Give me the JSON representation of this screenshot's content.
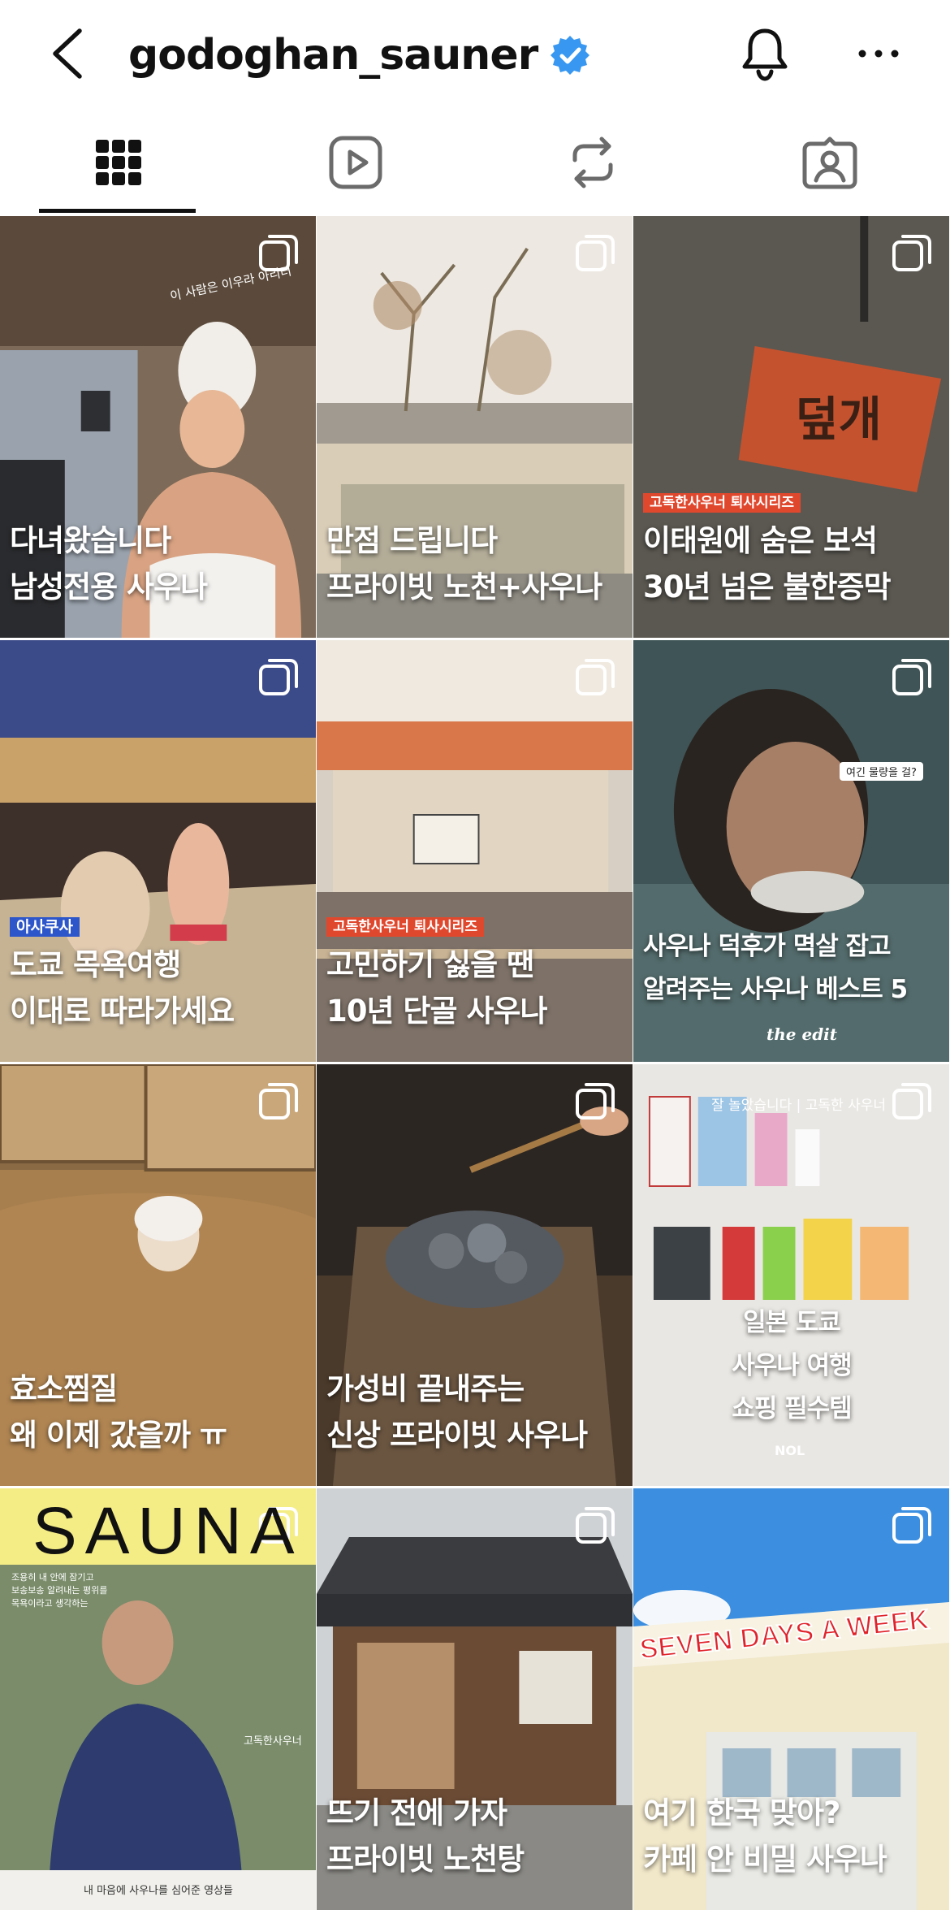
{
  "header": {
    "username": "godoghan_sauner",
    "back_icon": "chevron-left-icon",
    "verified_icon": "verified-badge-icon",
    "bell_icon": "bell-icon",
    "more_icon": "more-horizontal-icon",
    "verified_color": "#3897f0"
  },
  "tabs": [
    {
      "name": "grid",
      "icon": "grid-icon",
      "selected": true
    },
    {
      "name": "reels",
      "icon": "reels-icon",
      "selected": false
    },
    {
      "name": "reposts",
      "icon": "repost-icon",
      "selected": false
    },
    {
      "name": "tagged",
      "icon": "tagged-user-icon",
      "selected": false
    }
  ],
  "posts": [
    {
      "lines": [
        "다녀왔습니다",
        "남성전용 사우나"
      ],
      "overlay": "이 사람은 이우라 아리터"
    },
    {
      "lines": [
        "만점 드립니다",
        "프라이빗 노천+사우나"
      ]
    },
    {
      "badge": "고독한사우너 퇴사시리즈",
      "lines": [
        "이태원에 숨은 보석",
        "30년 넘은 불한증막"
      ],
      "sign": "덮개"
    },
    {
      "badge": "아사쿠사",
      "lines": [
        "도쿄 목욕여행",
        "이대로 따라가세요"
      ]
    },
    {
      "badge": "고독한사우너 퇴사시리즈",
      "lines": [
        "고민하기 싫을 땐",
        "10년 단골 사우나"
      ]
    },
    {
      "lines": [
        "사우나 덕후가 멱살 잡고",
        "알려주는 사우나 베스트 5"
      ],
      "tag": "여긴 물량을 걸?",
      "brand": "the edit"
    },
    {
      "lines": [
        "효소찜질",
        "왜 이제 갔을까 ㅠ"
      ]
    },
    {
      "lines": [
        "가성비 끝내주는",
        "신상 프라이빗 사우나"
      ]
    },
    {
      "lines": [
        "일본 도쿄",
        "사우나 여행",
        "쇼핑 필수템"
      ],
      "top_text": "잘 놀았습니다 | 고독한 사우너",
      "brand": "NOL"
    },
    {
      "headline": "SAUNA",
      "lines": [],
      "small_text": [
        "조용히 내 안에 잠기고",
        "보송보송 알려내는 평위를",
        "목욕이라고 생각하는"
      ],
      "side_text": "고독한사우너",
      "bottom_text": "내 마음에 사우나를 심어준 영상들"
    },
    {
      "lines": [
        "뜨기 전에 가자",
        "프라이빗 노천탕"
      ]
    },
    {
      "lines": [
        "여기 한국 맞아?",
        "카페 안 비밀 사우나"
      ],
      "sign": "SEVEN DAYS A WEEK"
    }
  ]
}
